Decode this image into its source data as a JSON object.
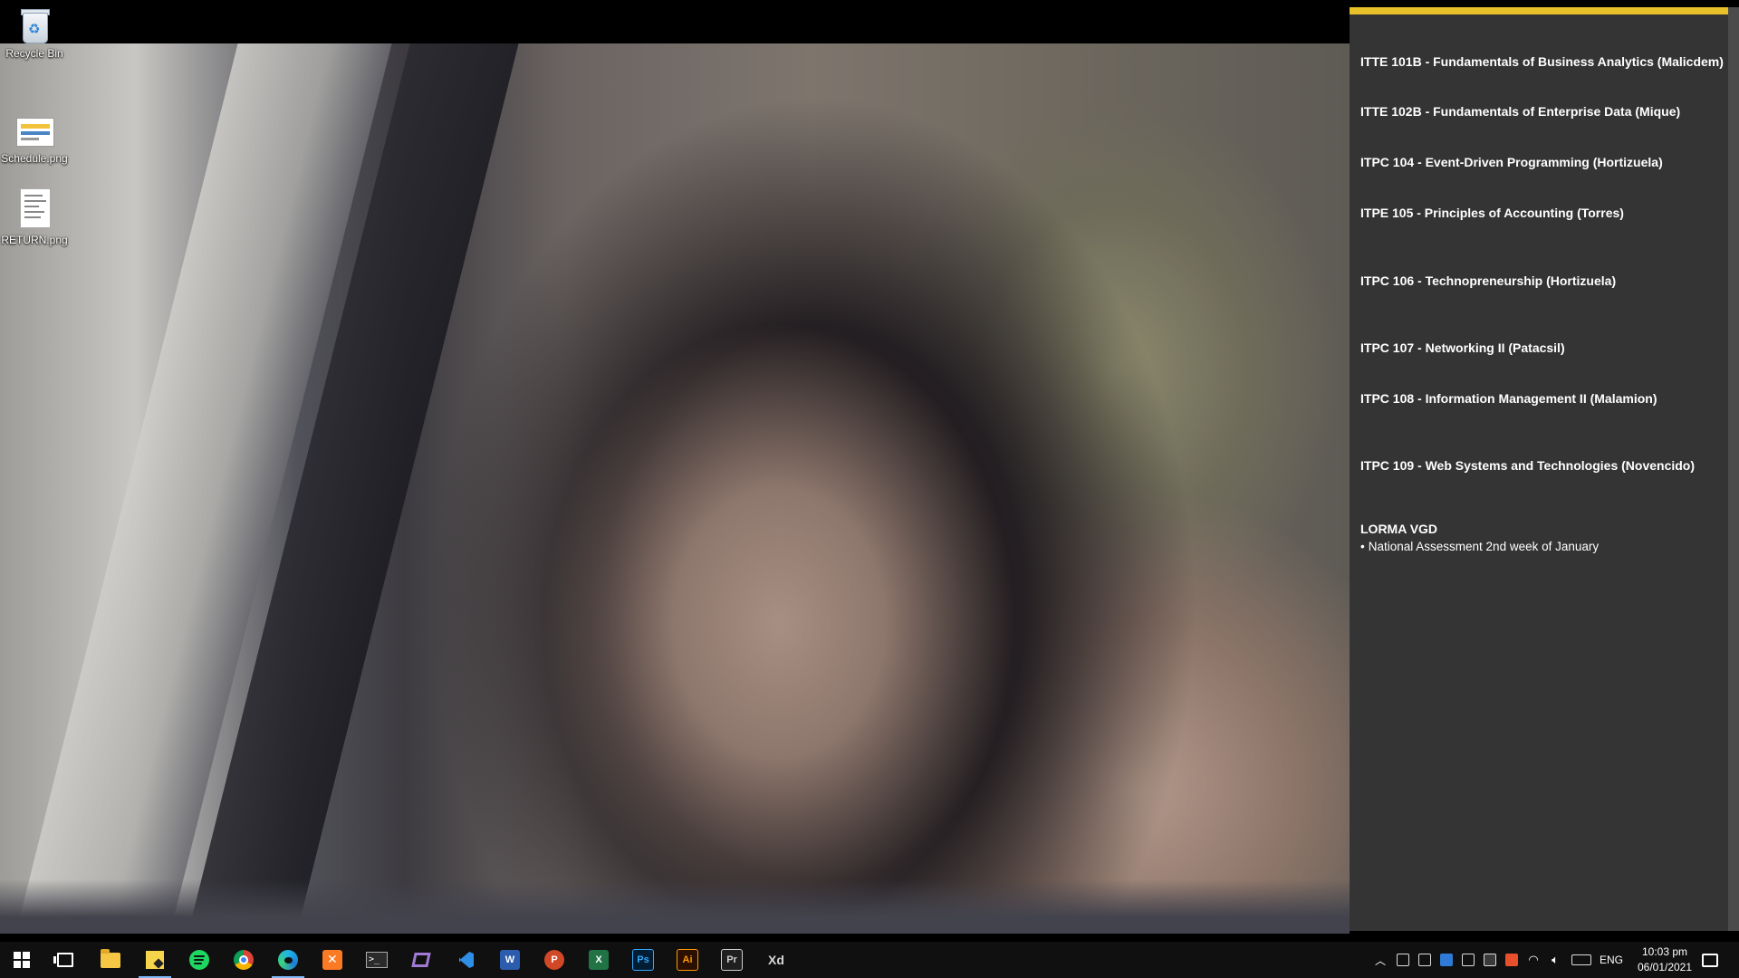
{
  "desktop": {
    "icons": [
      {
        "label": "Recycle Bin",
        "icon": "recycle-bin-icon"
      },
      {
        "label": "Schedule.png",
        "icon": "image-file-icon"
      },
      {
        "label": "RETURN.png",
        "icon": "image-file-icon"
      }
    ]
  },
  "sticky_note": {
    "accent_color": "#e8c12a",
    "courses": [
      "ITTE 101B - Fundamentals of Business Analytics (Malicdem)",
      "ITTE 102B - Fundamentals of Enterprise Data (Mique)",
      "ITPC 104 - Event-Driven Programming (Hortizuela)",
      "ITPE 105 - Principles of Accounting (Torres)",
      "ITPC 106 - Technopreneurship (Hortizuela)",
      "ITPC 107 - Networking II (Patacsil)",
      "ITPC 108 - Information Management II (Malamion)",
      "ITPC 109 - Web Systems and Technologies (Novencido)"
    ],
    "note_title": "LORMA VGD",
    "note_bullet": "National Assessment 2nd week of January"
  },
  "taskbar": {
    "apps": [
      {
        "name": "start-button",
        "icon": "windows-icon"
      },
      {
        "name": "task-view-button",
        "icon": "task-view-icon"
      },
      {
        "name": "file-explorer-button",
        "icon": "folder-icon"
      },
      {
        "name": "sticky-notes-button",
        "icon": "sticky-notes-icon"
      },
      {
        "name": "spotify-button",
        "icon": "spotify-icon"
      },
      {
        "name": "chrome-button",
        "icon": "chrome-icon"
      },
      {
        "name": "edge-button",
        "icon": "edge-icon"
      },
      {
        "name": "xampp-button",
        "icon": "xampp-icon"
      },
      {
        "name": "terminal-button",
        "icon": "terminal-icon"
      },
      {
        "name": "visual-studio-button",
        "icon": "visual-studio-icon"
      },
      {
        "name": "vscode-button",
        "icon": "vscode-icon"
      },
      {
        "name": "word-button",
        "icon": "word-icon",
        "label": "W"
      },
      {
        "name": "powerpoint-button",
        "icon": "powerpoint-icon",
        "label": "P"
      },
      {
        "name": "excel-button",
        "icon": "excel-icon",
        "label": "X"
      },
      {
        "name": "photoshop-button",
        "icon": "photoshop-icon",
        "label": "Ps"
      },
      {
        "name": "illustrator-button",
        "icon": "illustrator-icon",
        "label": "Ai"
      },
      {
        "name": "premiere-button",
        "icon": "premiere-icon",
        "label": "Pr"
      },
      {
        "name": "xd-button",
        "icon": "xd-icon",
        "label": "Xd"
      }
    ],
    "language": "ENG",
    "time": "10:03 pm",
    "date": "06/01/2021"
  }
}
